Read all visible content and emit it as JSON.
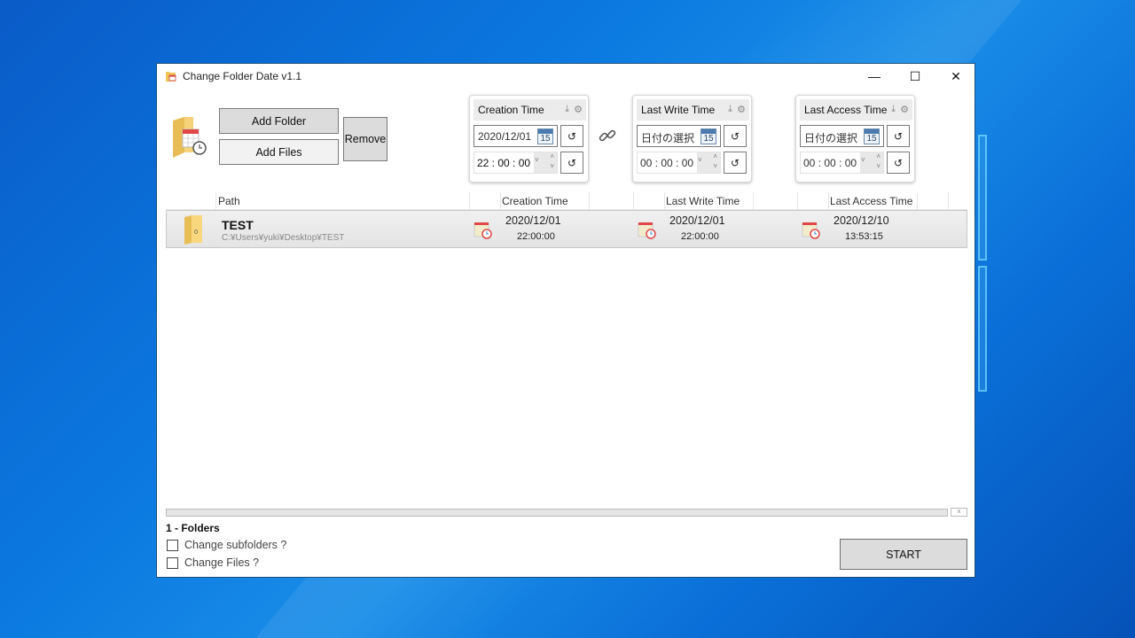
{
  "window": {
    "title": "Change Folder Date v1.1",
    "controls": {
      "minimize": "—",
      "maximize": "☐",
      "close": "✕"
    }
  },
  "toolbar": {
    "add_folder_label": "Add Folder",
    "add_files_label": "Add Files",
    "remove_label": "Remove"
  },
  "time_cards": [
    {
      "title": "Creation Time",
      "date_value": "2020/12/01",
      "time_value": "22 : 00 : 00",
      "calendar_day": "15"
    },
    {
      "title": "Last Write Time",
      "date_value": "日付の選択",
      "time_value": "00 : 00 : 00",
      "calendar_day": "15"
    },
    {
      "title": "Last Access Time",
      "date_value": "日付の選択",
      "time_value": "00 : 00 : 00",
      "calendar_day": "15"
    }
  ],
  "icons": {
    "download": "⤓",
    "gear": "⚙",
    "reset": "↺",
    "spin_drop": "˅",
    "spin_up": "˄",
    "spin_down": "˅"
  },
  "list": {
    "columns": [
      "Path",
      "Creation Time",
      "Last Write Time",
      "Last Access Time"
    ],
    "rows": [
      {
        "badge": "0",
        "name": "TEST",
        "path": "C:¥Users¥yuki¥Desktop¥TEST",
        "creation": {
          "date": "2020/12/01",
          "time": "22:00:00"
        },
        "last_write": {
          "date": "2020/12/01",
          "time": "22:00:00"
        },
        "last_access": {
          "date": "2020/12/10",
          "time": "13:53:15"
        }
      }
    ]
  },
  "progress": {
    "value": 0,
    "clear_label": "x"
  },
  "footer": {
    "count_label": "1 - Folders",
    "change_subfolders_label": "Change subfolders ?",
    "change_subfolders_checked": false,
    "change_files_label": "Change Files ?",
    "change_files_checked": false,
    "start_label": "START"
  }
}
